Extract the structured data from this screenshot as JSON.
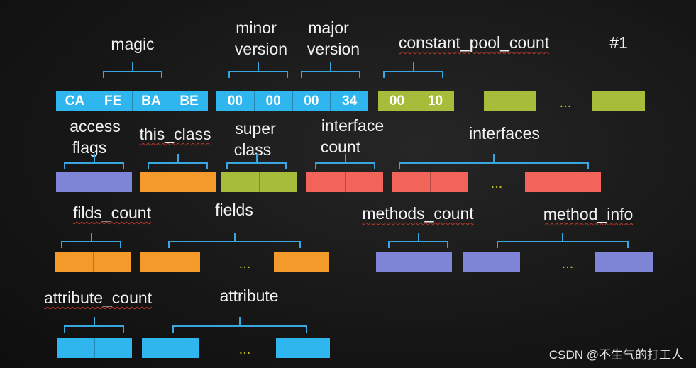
{
  "colors": {
    "cyan": "#2fb6ee",
    "green": "#a8bc3c",
    "purple": "#7e85d6",
    "orange": "#f39a2b",
    "red": "#f2645a",
    "brace": "#3aa6df"
  },
  "labels": {
    "magic": "magic",
    "minor_1": "minor",
    "minor_2": "version",
    "major_1": "major",
    "major_2": "version",
    "constant_pool_count": "constant_pool_count",
    "index": "#1",
    "access_1": "access",
    "access_2": "flags",
    "this_class": "this_class",
    "super_1": "super",
    "super_2": "class",
    "icount_1": "interface",
    "icount_2": "count",
    "interfaces": "interfaces",
    "filds_count": "filds_count",
    "fields": "fields",
    "methods_count": "methods_count",
    "method_info": "method_info",
    "attribute_count": "attribute_count",
    "attribute": "attribute"
  },
  "bytes": {
    "magic": [
      "CA",
      "FE",
      "BA",
      "BE"
    ],
    "version": [
      "00",
      "00",
      "00",
      "34"
    ],
    "constant_pool_count": [
      "00",
      "10"
    ]
  },
  "ellipsis": "...",
  "watermark": "CSDN @不生气的打工人"
}
